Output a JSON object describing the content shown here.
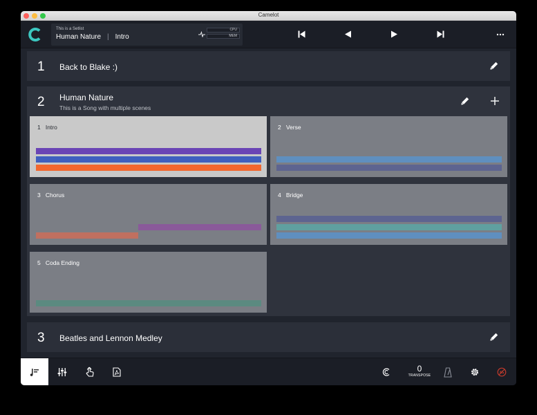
{
  "window": {
    "title": "Camelot"
  },
  "header": {
    "subtitle": "This is a Setlist",
    "song": "Human Nature",
    "separator": "|",
    "scene": "Intro",
    "cpu_label": "CPU",
    "mem_label": "MEM"
  },
  "setlist": {
    "rows": [
      {
        "number": "1",
        "name": "Back to Blake :)"
      },
      {
        "number": "2",
        "name": "Human Nature",
        "description": "This is a Song with multiple scenes"
      },
      {
        "number": "3",
        "name": "Beatles and Lennon Medley"
      }
    ],
    "scenes": [
      {
        "number": "1",
        "name": "Intro",
        "active": true
      },
      {
        "number": "2",
        "name": "Verse",
        "active": false
      },
      {
        "number": "3",
        "name": "Chorus",
        "active": false
      },
      {
        "number": "4",
        "name": "Bridge",
        "active": false
      },
      {
        "number": "5",
        "name": "Coda Ending",
        "active": false
      }
    ]
  },
  "footer": {
    "transpose_value": "0",
    "transpose_label": "TRANSPOSE"
  },
  "icons": {
    "logo": "camelot-logo-icon",
    "first": "skip-to-start-icon",
    "prev": "previous-icon",
    "next": "next-icon",
    "last": "skip-to-end-icon",
    "more": "more-icon",
    "edit": "pencil-icon",
    "add": "plus-icon",
    "setlist_tab": "setlist-icon",
    "mixer_tab": "mixer-icon",
    "touch_tab": "touch-icon",
    "pdf_tab": "pdf-icon",
    "link": "link-icon",
    "metronome": "metronome-icon",
    "settings": "gear-icon",
    "panic": "panic-icon"
  },
  "colors": {
    "accent": "#3cc7c0",
    "active_scene": "#c9c9c9",
    "inactive_scene": "#7b7e85",
    "purple": "#6a44b5",
    "blue": "#3f5fbf",
    "orange": "#f2672f",
    "steel_blue": "#5f8fbf",
    "slate": "#5d6490",
    "violet": "#8a5a9a",
    "salmon": "#c07060",
    "teal": "#5fa0a0",
    "green_teal": "#5b8a80",
    "panic_red": "#c0392b"
  }
}
